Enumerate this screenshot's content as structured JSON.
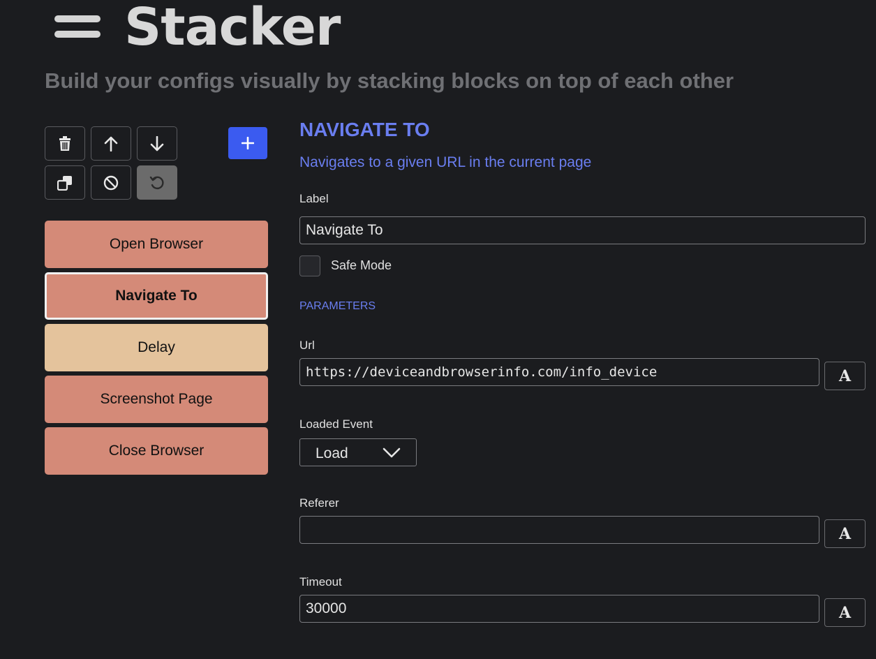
{
  "header": {
    "title": "Stacker",
    "subtitle": "Build your configs visually by stacking blocks on top of each other"
  },
  "toolbar": {
    "buttons": [
      {
        "icon": "trash-icon",
        "action": "delete"
      },
      {
        "icon": "arrow-up-icon",
        "action": "move-up"
      },
      {
        "icon": "arrow-down-icon",
        "action": "move-down"
      },
      {
        "icon": "duplicate-icon",
        "action": "clone"
      },
      {
        "icon": "ban-icon",
        "action": "disable"
      },
      {
        "icon": "undo-icon",
        "action": "reset",
        "disabled": true
      }
    ],
    "add_icon": "plus-icon",
    "add_color": "#3b5bf0"
  },
  "stack": {
    "blocks": [
      {
        "label": "Open Browser",
        "color": "#d48a78"
      },
      {
        "label": "Navigate To",
        "color": "#d48a78",
        "selected": true
      },
      {
        "label": "Delay",
        "color": "#e4c39c"
      },
      {
        "label": "Screenshot Page",
        "color": "#d48a78"
      },
      {
        "label": "Close Browser",
        "color": "#d48a78"
      }
    ]
  },
  "panel": {
    "title": "NAVIGATE TO",
    "description": "Navigates to a given URL in the current page",
    "label_field": {
      "label": "Label",
      "value": "Navigate To"
    },
    "safe_mode": {
      "label": "Safe Mode",
      "checked": false
    },
    "parameters_heading": "PARAMETERS",
    "url": {
      "label": "Url",
      "value": "https://deviceandbrowserinfo.com/info_device"
    },
    "loaded_event": {
      "label": "Loaded Event",
      "value": "Load"
    },
    "referer": {
      "label": "Referer",
      "value": ""
    },
    "timeout": {
      "label": "Timeout",
      "value": "30000"
    },
    "type_toggle_glyph": "A",
    "accent": "#6a7ef0"
  }
}
